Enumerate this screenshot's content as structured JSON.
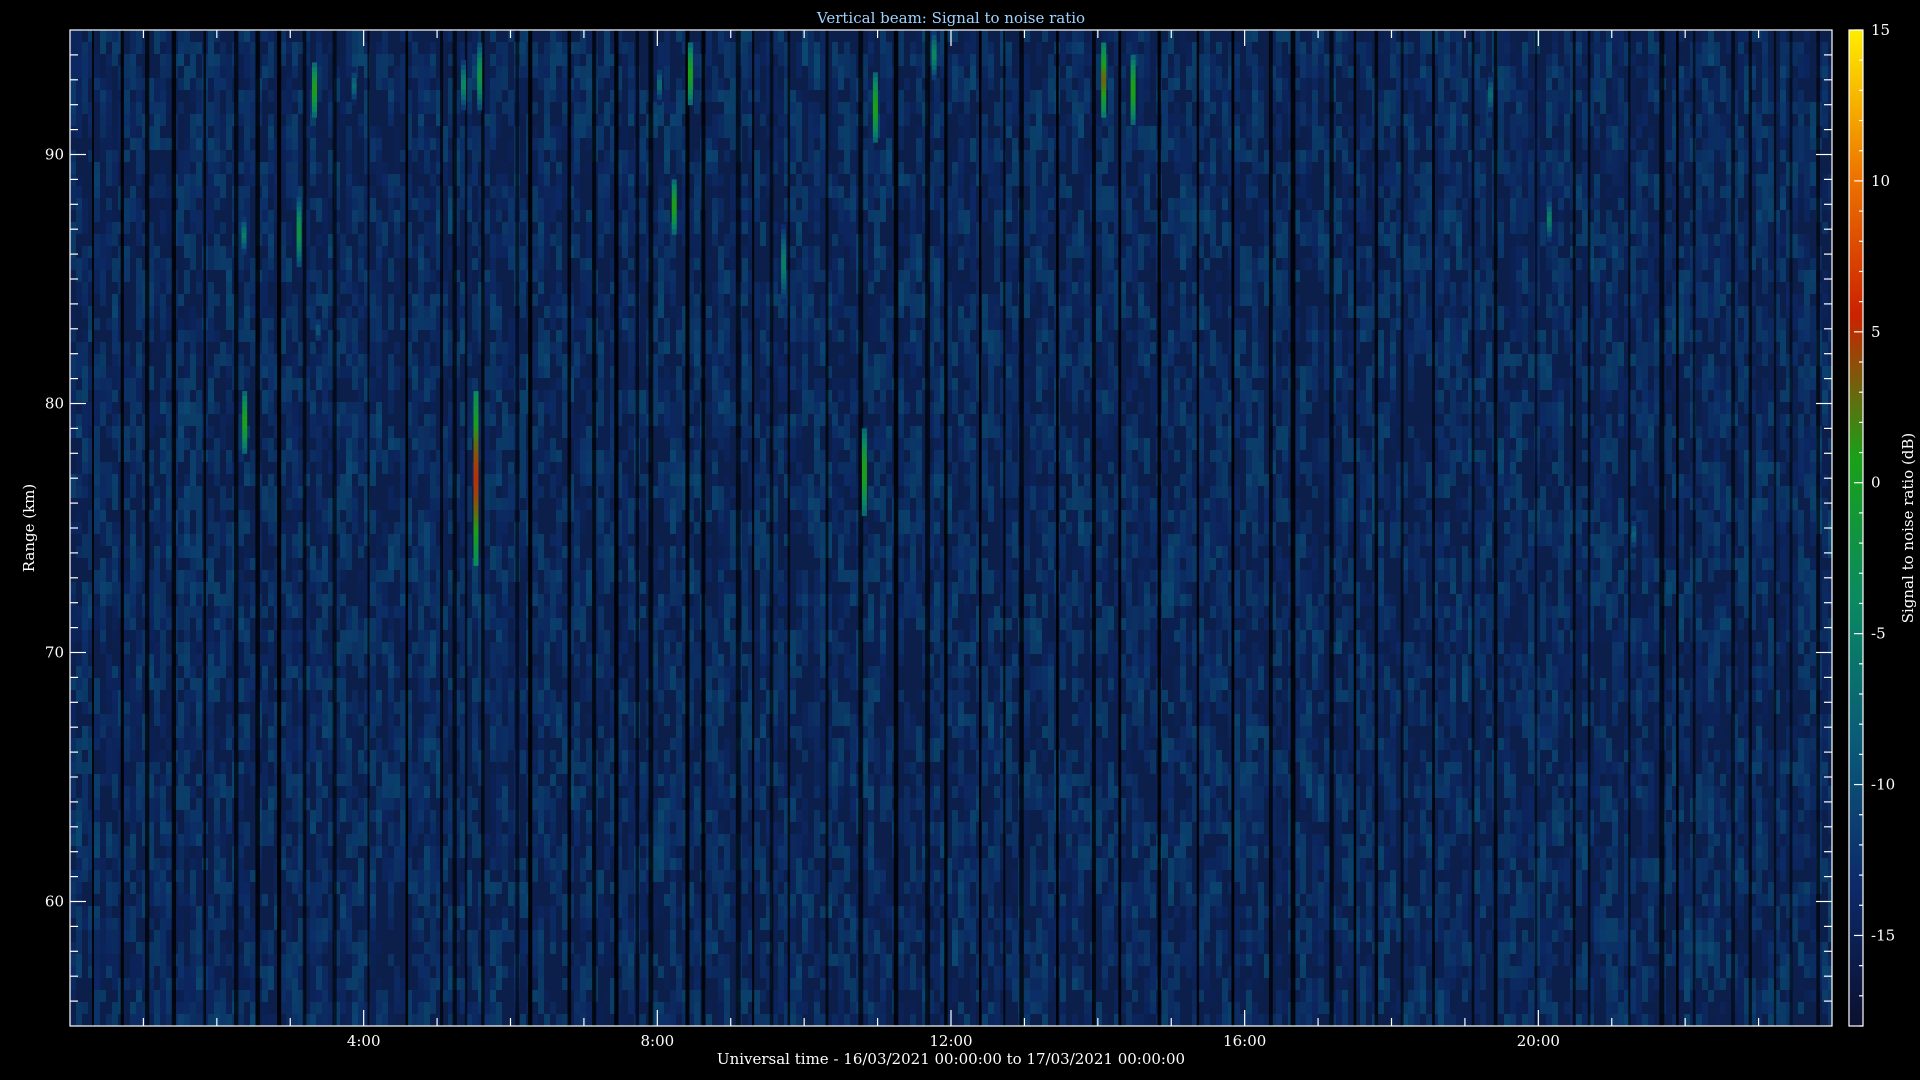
{
  "chart_data": {
    "type": "heatmap",
    "title": "Vertical beam: Signal to noise ratio",
    "xlabel": "Universal time - 16/03/2021 00:00:00 to 17/03/2021 00:00:00",
    "ylabel": "Range (km)",
    "x_unit": "hours UT",
    "xlim": [
      0,
      24
    ],
    "ylim": [
      55,
      95
    ],
    "x_ticks": [
      4,
      8,
      12,
      16,
      20
    ],
    "x_tick_labels": [
      "4:00",
      "8:00",
      "12:00",
      "16:00",
      "20:00"
    ],
    "y_ticks": [
      60,
      70,
      80,
      90
    ],
    "y_tick_labels": [
      "60",
      "70",
      "80",
      "90"
    ],
    "colorbar": {
      "label": "Signal to noise ratio (dB)",
      "range": [
        -18,
        15
      ],
      "ticks": [
        -15,
        -10,
        -5,
        0,
        5,
        10,
        15
      ],
      "tick_labels": [
        "-15",
        "-10",
        "-5",
        "0",
        "5",
        "10",
        "15"
      ],
      "colors": [
        "#0b1030",
        "#0d2a6a",
        "#0a5a78",
        "#0a8a60",
        "#1aa018",
        "#cc2200",
        "#ee7700",
        "#ffee00"
      ]
    },
    "background_level_db": -15,
    "echoes": [
      {
        "time": 2.37,
        "range_from": 86.0,
        "range_to": 87.5,
        "snr_peak": -5
      },
      {
        "time": 2.38,
        "range_from": 78.0,
        "range_to": 80.5,
        "snr_peak": 1
      },
      {
        "time": 3.12,
        "range_from": 85.5,
        "range_to": 88.3,
        "snr_peak": -2
      },
      {
        "time": 3.33,
        "range_from": 91.5,
        "range_to": 93.7,
        "snr_peak": 1
      },
      {
        "time": 3.38,
        "range_from": 82.3,
        "range_to": 83.6,
        "snr_peak": -9
      },
      {
        "time": 3.87,
        "range_from": 92.0,
        "range_to": 93.5,
        "snr_peak": -7
      },
      {
        "time": 5.36,
        "range_from": 91.8,
        "range_to": 93.8,
        "snr_peak": -4
      },
      {
        "time": 5.53,
        "range_from": 73.5,
        "range_to": 80.5,
        "snr_peak": 5
      },
      {
        "time": 5.58,
        "range_from": 91.8,
        "range_to": 94.5,
        "snr_peak": -2
      },
      {
        "time": 8.03,
        "range_from": 92.0,
        "range_to": 93.6,
        "snr_peak": -7
      },
      {
        "time": 8.23,
        "range_from": 86.8,
        "range_to": 89.0,
        "snr_peak": 1
      },
      {
        "time": 8.45,
        "range_from": 92.0,
        "range_to": 94.5,
        "snr_peak": 1
      },
      {
        "time": 9.72,
        "range_from": 84.0,
        "range_to": 87.2,
        "snr_peak": -5
      },
      {
        "time": 10.82,
        "range_from": 75.5,
        "range_to": 79.0,
        "snr_peak": 1
      },
      {
        "time": 10.97,
        "range_from": 90.5,
        "range_to": 93.3,
        "snr_peak": 1
      },
      {
        "time": 11.77,
        "range_from": 93.0,
        "range_to": 95.0,
        "snr_peak": -4
      },
      {
        "time": 14.08,
        "range_from": 91.5,
        "range_to": 94.5,
        "snr_peak": 3
      },
      {
        "time": 14.48,
        "range_from": 91.2,
        "range_to": 94.0,
        "snr_peak": 1
      },
      {
        "time": 19.35,
        "range_from": 91.5,
        "range_to": 93.3,
        "snr_peak": -7
      },
      {
        "time": 20.15,
        "range_from": 86.5,
        "range_to": 88.3,
        "snr_peak": -5
      },
      {
        "time": 21.3,
        "range_from": 74.0,
        "range_to": 75.5,
        "snr_peak": -8
      }
    ]
  }
}
